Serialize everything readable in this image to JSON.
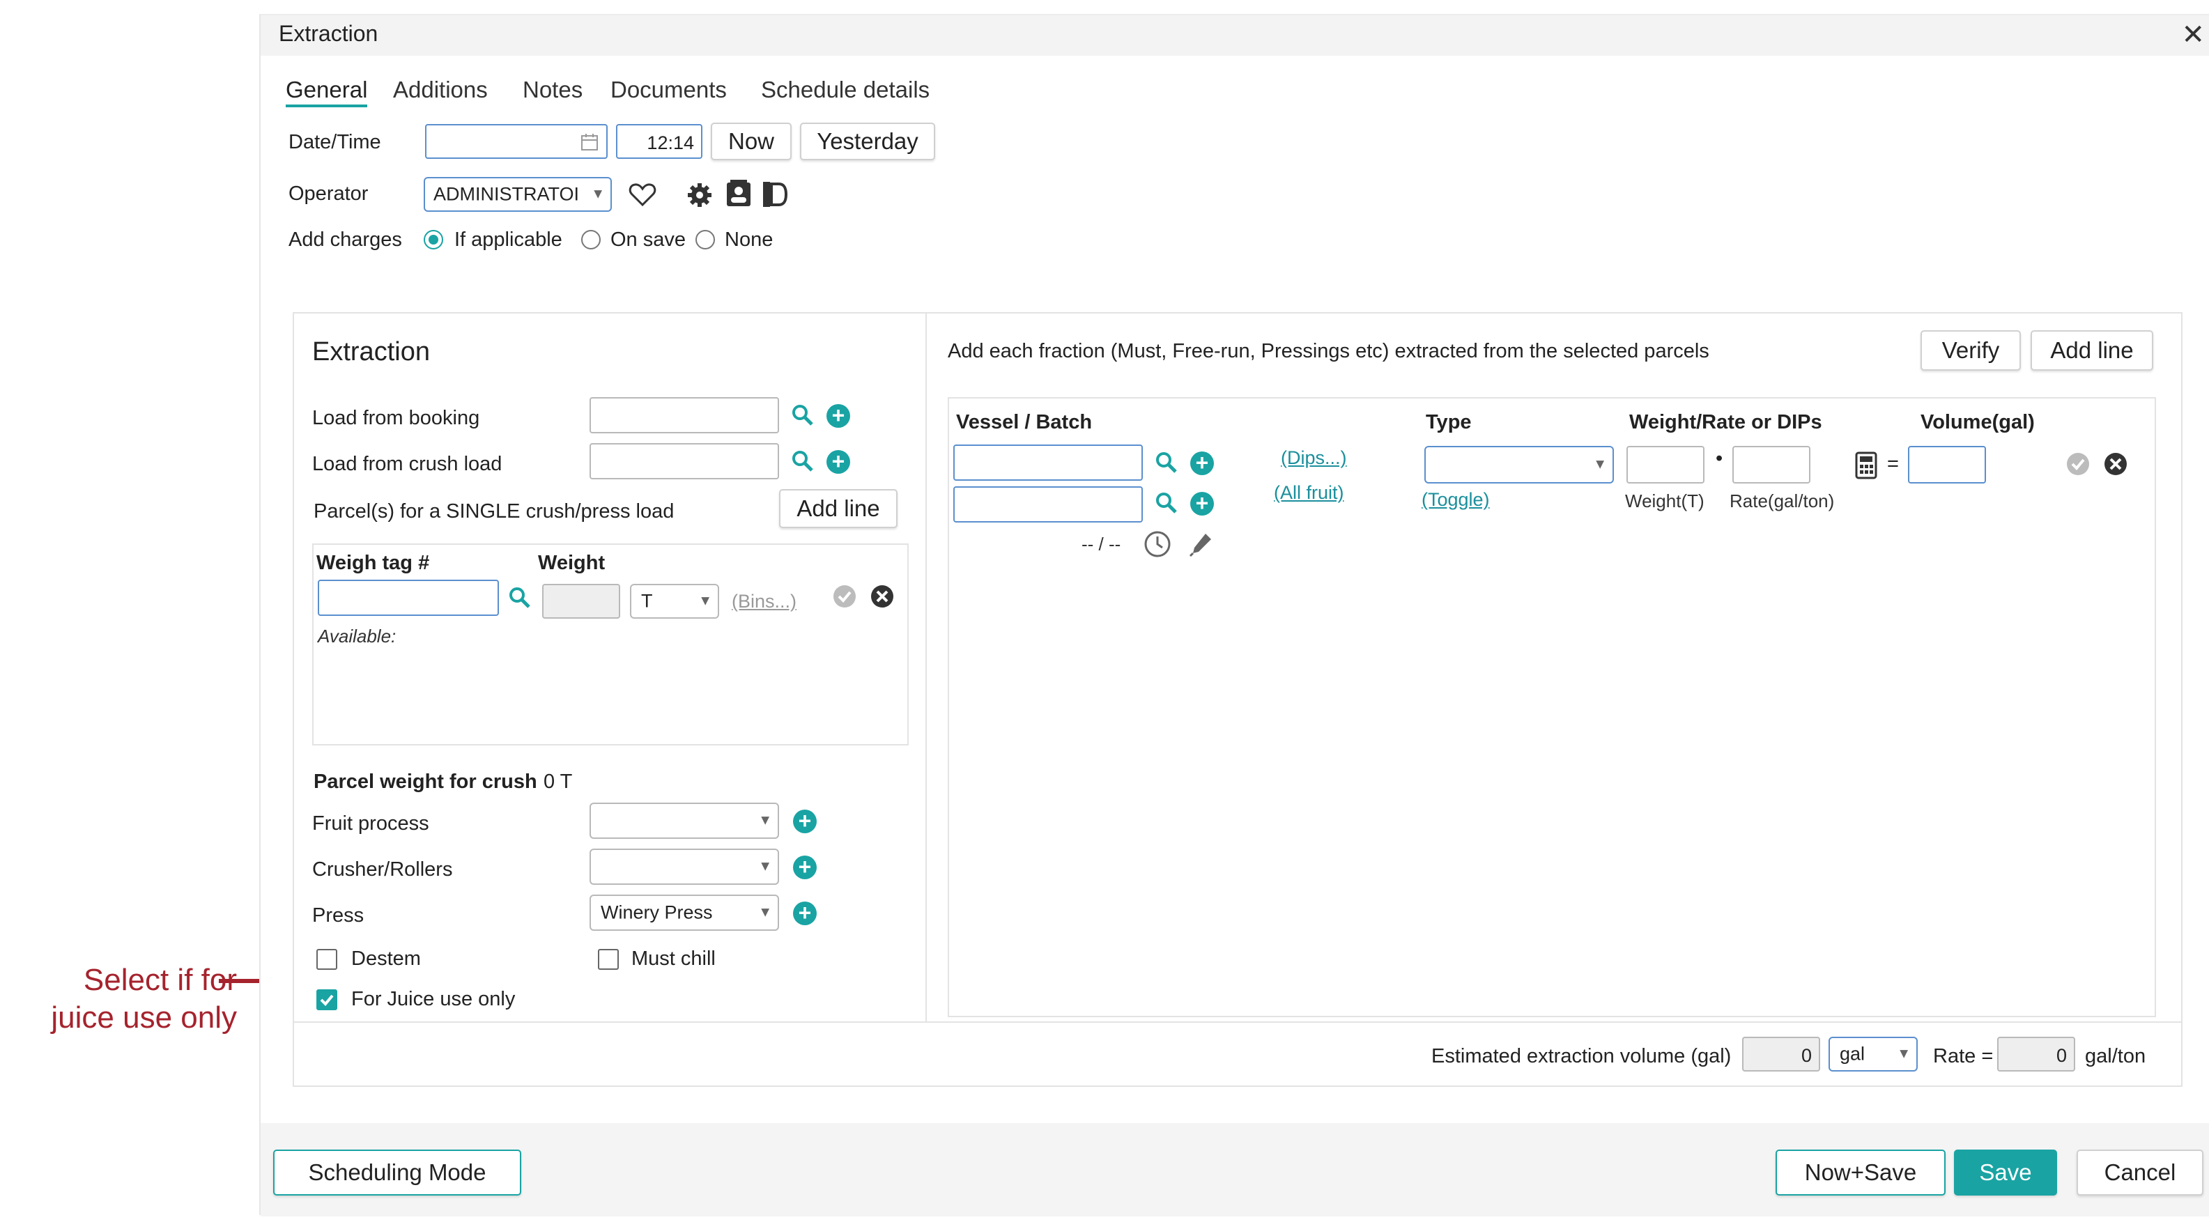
{
  "dialog": {
    "title": "Extraction"
  },
  "tabs": [
    "General",
    "Additions",
    "Notes",
    "Documents",
    "Schedule details"
  ],
  "general": {
    "datetime_label": "Date/Time",
    "date_value": "",
    "time_value": "12:14",
    "now_label": "Now",
    "yesterday_label": "Yesterday",
    "operator_label": "Operator",
    "operator_value": "ADMINISTRATOI",
    "add_charges_label": "Add charges",
    "charge_options": [
      "If applicable",
      "On save",
      "None"
    ],
    "charge_selected": "If applicable"
  },
  "extraction": {
    "title": "Extraction",
    "load_booking_label": "Load from booking",
    "load_crush_label": "Load from crush load",
    "parcels_label": "Parcel(s) for a SINGLE crush/press load",
    "add_line_label": "Add line",
    "weigh_tag_header": "Weigh tag #",
    "weight_header": "Weight",
    "unit_value": "T",
    "bins_link": "(Bins...)",
    "available_label": "Available:",
    "parcel_weight_label": "Parcel weight for crush",
    "parcel_weight_value": "0 T",
    "fruit_process_label": "Fruit process",
    "crusher_label": "Crusher/Rollers",
    "press_label": "Press",
    "press_value": "Winery Press",
    "destem_label": "Destem",
    "must_chill_label": "Must chill",
    "juice_label": "For Juice use only",
    "juice_checked": true
  },
  "fractions": {
    "intro": "Add each fraction (Must, Free-run, Pressings etc) extracted from the selected parcels",
    "verify_label": "Verify",
    "add_line_label": "Add line",
    "col_vessel": "Vessel / Batch",
    "col_type": "Type",
    "col_weight_rate": "Weight/Rate or DIPs",
    "col_volume": "Volume(gal)",
    "dips_link": "(Dips...)",
    "all_fruit_link": "(All fruit)",
    "toggle_link": "(Toggle)",
    "weight_sub": "Weight(T)",
    "rate_sub": "Rate(gal/ton)",
    "time_placeholder": "-- / --",
    "dot": "•",
    "equals": "="
  },
  "estimate": {
    "label": "Estimated extraction volume (gal)",
    "value": "0",
    "unit": "gal",
    "rate_label": "Rate =",
    "rate_value": "0",
    "rate_unit": "gal/ton"
  },
  "footer": {
    "scheduling_label": "Scheduling Mode",
    "now_save_label": "Now+Save",
    "save_label": "Save",
    "cancel_label": "Cancel"
  },
  "annotation": {
    "line1": "Select if for",
    "line2": "juice use only",
    "color": "#a5232d"
  },
  "colors": {
    "accent": "#1aa3a3"
  }
}
